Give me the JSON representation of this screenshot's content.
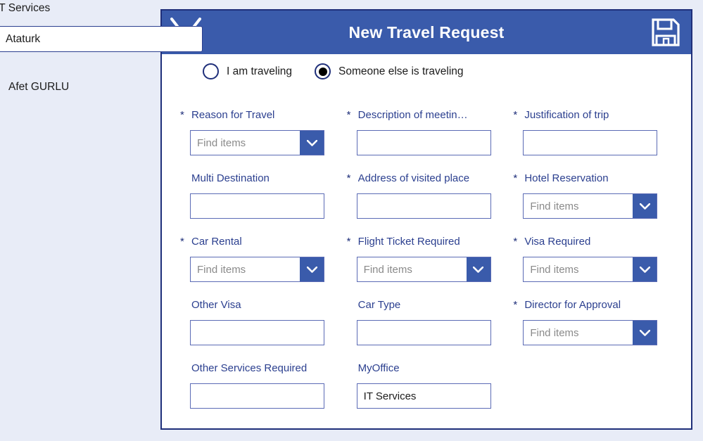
{
  "sidebar": {
    "top_label": "IT Services",
    "person": "Afet GURLU",
    "overlay_value": "Ataturk"
  },
  "header": {
    "title": "New Travel Request",
    "save_icon": "save-floppy-icon",
    "collapse_icon": "collapse-chevrons-icon"
  },
  "traveler_options": [
    {
      "label": "I am traveling",
      "selected": false
    },
    {
      "label": "Someone else is traveling",
      "selected": true
    }
  ],
  "colors": {
    "header_blue": "#3a5bab",
    "panel_border": "#1f2f7a",
    "label_blue": "#2b3f8f",
    "background": "#e8ecf7",
    "placeholder_gray": "#8a8a8a"
  },
  "form": {
    "dropdown_placeholder": "Find items",
    "rows": [
      [
        {
          "label": "Reason for Travel",
          "required": true,
          "type": "dropdown",
          "value": "",
          "placeholder": "Find items"
        },
        {
          "label": "Description of meetin…",
          "required": true,
          "type": "text",
          "value": "",
          "placeholder": ""
        },
        {
          "label": "Justification of trip",
          "required": true,
          "type": "text",
          "value": "",
          "placeholder": ""
        }
      ],
      [
        {
          "label": "Multi Destination",
          "required": false,
          "type": "text",
          "value": "",
          "placeholder": ""
        },
        {
          "label": "Address of visited place",
          "required": true,
          "type": "text",
          "value": "",
          "placeholder": ""
        },
        {
          "label": "Hotel Reservation",
          "required": true,
          "type": "dropdown",
          "value": "",
          "placeholder": "Find items"
        }
      ],
      [
        {
          "label": "Car Rental",
          "required": true,
          "type": "dropdown",
          "value": "",
          "placeholder": "Find items"
        },
        {
          "label": "Flight Ticket Required",
          "required": true,
          "type": "dropdown",
          "value": "",
          "placeholder": "Find items"
        },
        {
          "label": "Visa Required",
          "required": true,
          "type": "dropdown",
          "value": "",
          "placeholder": "Find items"
        }
      ],
      [
        {
          "label": "Other Visa",
          "required": false,
          "type": "text",
          "value": "",
          "placeholder": ""
        },
        {
          "label": "Car Type",
          "required": false,
          "type": "text",
          "value": "",
          "placeholder": ""
        },
        {
          "label": "Director for Approval",
          "required": true,
          "type": "dropdown",
          "value": "",
          "placeholder": "Find items"
        }
      ],
      [
        {
          "label": "Other Services Required",
          "required": false,
          "type": "text",
          "value": "",
          "placeholder": ""
        },
        {
          "label": "MyOffice",
          "required": false,
          "type": "text",
          "value": "IT Services",
          "placeholder": ""
        },
        {
          "label": "",
          "required": false,
          "type": "none",
          "value": "",
          "placeholder": ""
        }
      ]
    ]
  }
}
